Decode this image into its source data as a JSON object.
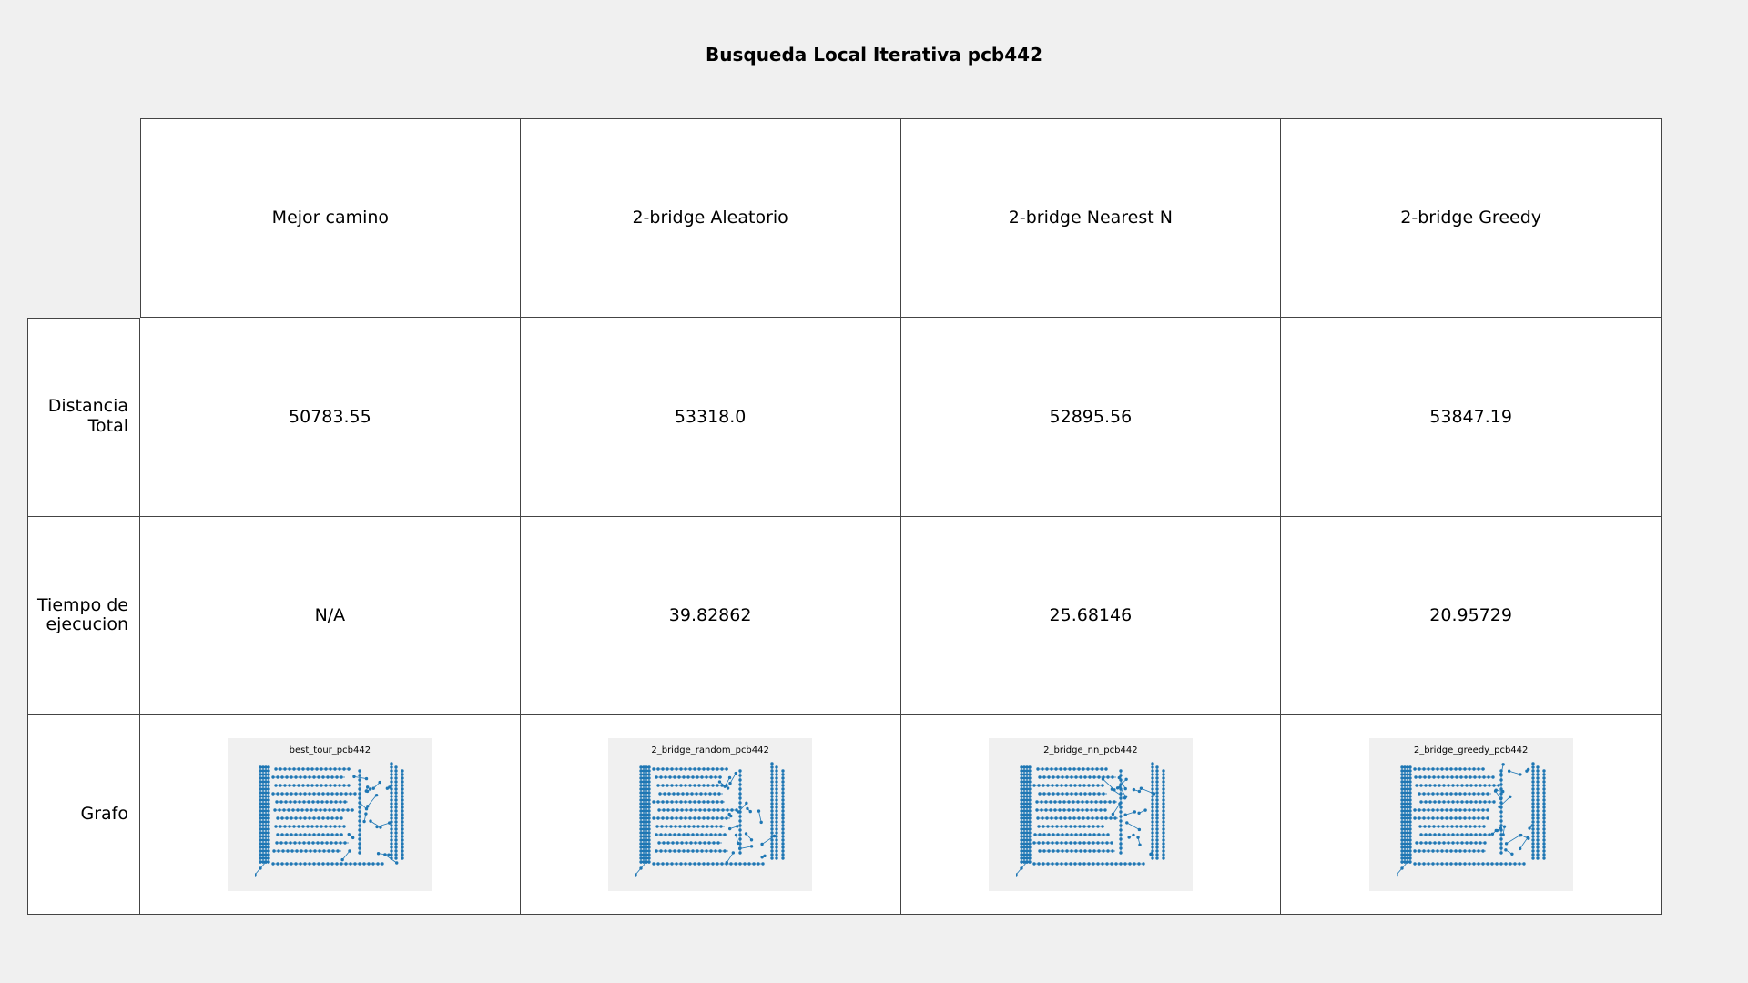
{
  "title": "Busqueda Local Iterativa pcb442",
  "columns": [
    "Mejor camino",
    "2-bridge Aleatorio",
    "2-bridge Nearest N",
    "2-bridge Greedy"
  ],
  "rows": [
    {
      "label": "Distancia Total",
      "values": [
        "50783.55",
        "53318.0",
        "52895.56",
        "53847.19"
      ]
    },
    {
      "label": "Tiempo de ejecucion",
      "values": [
        "N/A",
        "39.82862",
        "25.68146",
        "20.95729"
      ]
    },
    {
      "label": "Grafo",
      "images": [
        "best_tour_pcb442",
        "2_bridge_random_pcb442",
        "2_bridge_nn_pcb442",
        "2_bridge_greedy_pcb442"
      ]
    }
  ],
  "colors": {
    "edge": "#1f77b4",
    "node": "#1f77b4",
    "card_background": "#f0f0f0"
  }
}
